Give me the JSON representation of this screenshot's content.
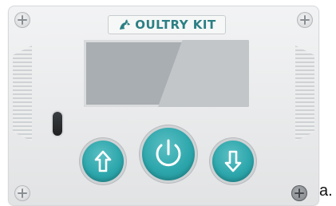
{
  "brand": {
    "name": "OULTRY KIT",
    "mark_icon": "rooster-head-icon",
    "color": "#2b7f83"
  },
  "controls": {
    "up_icon": "arrow-up-icon",
    "power_icon": "power-icon",
    "down_icon": "arrow-down-icon",
    "button_color": "#2da7ac"
  },
  "caption": {
    "label": "a."
  }
}
